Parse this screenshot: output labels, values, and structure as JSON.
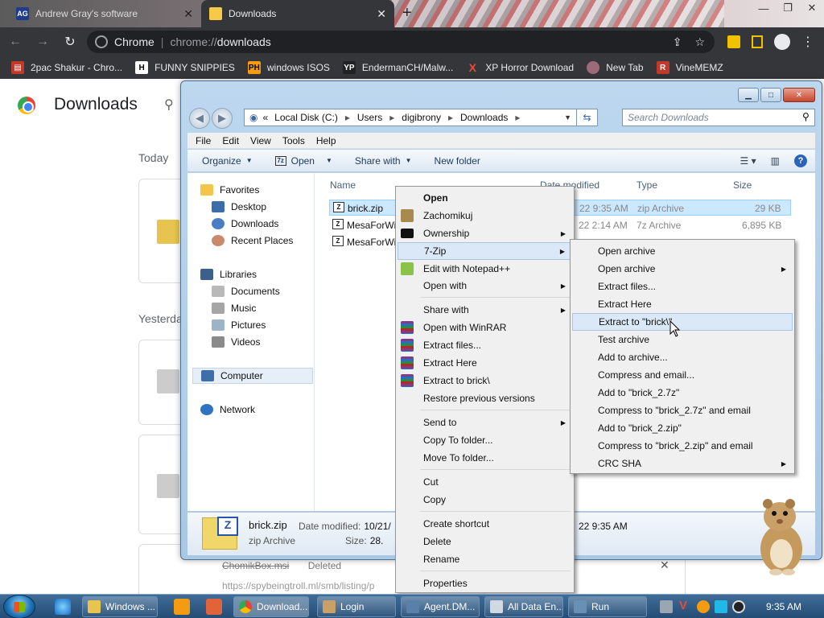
{
  "browser": {
    "tabs": [
      {
        "favicon": "AG",
        "title": "Andrew Gray's software"
      },
      {
        "favicon": "folder-icon",
        "title": "Downloads"
      }
    ],
    "omnibox": {
      "site": "Chrome",
      "url_prefix": "chrome://",
      "url_path": "downloads"
    },
    "bookmarks": [
      {
        "label": "2pac Shakur - Chro..."
      },
      {
        "label": "FUNNY SNIPPIES",
        "icon": "H"
      },
      {
        "label": "windows ISOS",
        "icon": "PH"
      },
      {
        "label": "EndermanCH/Malw...",
        "icon": "YP"
      },
      {
        "label": "XP Horror Download",
        "icon": "X"
      },
      {
        "label": "New Tab"
      },
      {
        "label": "VineMEMZ",
        "icon": "R"
      }
    ]
  },
  "downloads_page": {
    "title": "Downloads",
    "sections": {
      "today": "Today",
      "yesterday": "Yesterda"
    },
    "bottom_item": {
      "name": "ChomikBox.msi",
      "status": "Deleted",
      "url": "https://spybeingtroll.ml/smb/listing/p"
    }
  },
  "explorer": {
    "address": {
      "prefix": "«",
      "parts": [
        "Local Disk (C:)",
        "Users",
        "digibrony",
        "Downloads"
      ]
    },
    "search_placeholder": "Search Downloads",
    "menu": [
      "File",
      "Edit",
      "View",
      "Tools",
      "Help"
    ],
    "commands": {
      "organize": "Organize",
      "open": "Open",
      "share_with": "Share with",
      "new_folder": "New folder"
    },
    "sidebar": {
      "favorites": "Favorites",
      "fav_items": [
        "Desktop",
        "Downloads",
        "Recent Places"
      ],
      "libraries": "Libraries",
      "lib_items": [
        "Documents",
        "Music",
        "Pictures",
        "Videos"
      ],
      "computer": "Computer",
      "network": "Network"
    },
    "columns": {
      "name": "Name",
      "date": "Date modified",
      "type": "Type",
      "size": "Size"
    },
    "files": [
      {
        "name": "brick.zip",
        "date": "22 9:35 AM",
        "type": "zip Archive",
        "size": "29 KB"
      },
      {
        "name": "MesaForWi",
        "date": "22 2:14 AM",
        "type": "7z Archive",
        "size": "6,895 KB"
      },
      {
        "name": "MesaForWi",
        "date": "",
        "type": "",
        "size": ""
      }
    ],
    "details": {
      "name": "brick.zip",
      "type": "zip Archive",
      "date_label": "Date modified:",
      "date_value": "10/21/",
      "size_label": "Size:",
      "size_value": "28.",
      "time": "22 9:35 AM"
    }
  },
  "context_menu": {
    "items": [
      "Open",
      "Zachomikuj",
      "Ownership",
      "7-Zip",
      "Edit with Notepad++",
      "Open with",
      "Share with",
      "Open with WinRAR",
      "Extract files...",
      "Extract Here",
      "Extract to brick\\",
      "Restore previous versions",
      "Send to",
      "Copy To folder...",
      "Move To folder...",
      "Cut",
      "Copy",
      "Create shortcut",
      "Delete",
      "Rename",
      "Properties"
    ]
  },
  "sevenzip_menu": {
    "items": [
      "Open archive",
      "Open archive",
      "Extract files...",
      "Extract Here",
      "Extract to \"brick\\\"",
      "Test archive",
      "Add to archive...",
      "Compress and email...",
      "Add to \"brick_2.7z\"",
      "Compress to \"brick_2.7z\" and email",
      "Add to \"brick_2.zip\"",
      "Compress to \"brick_2.zip\" and email",
      "CRC SHA"
    ]
  },
  "taskbar": {
    "buttons": [
      "Windows ...",
      "Download...",
      "Login",
      "Agent.DM...",
      "All Data En...",
      "Run"
    ],
    "clock": "9:35 AM"
  }
}
